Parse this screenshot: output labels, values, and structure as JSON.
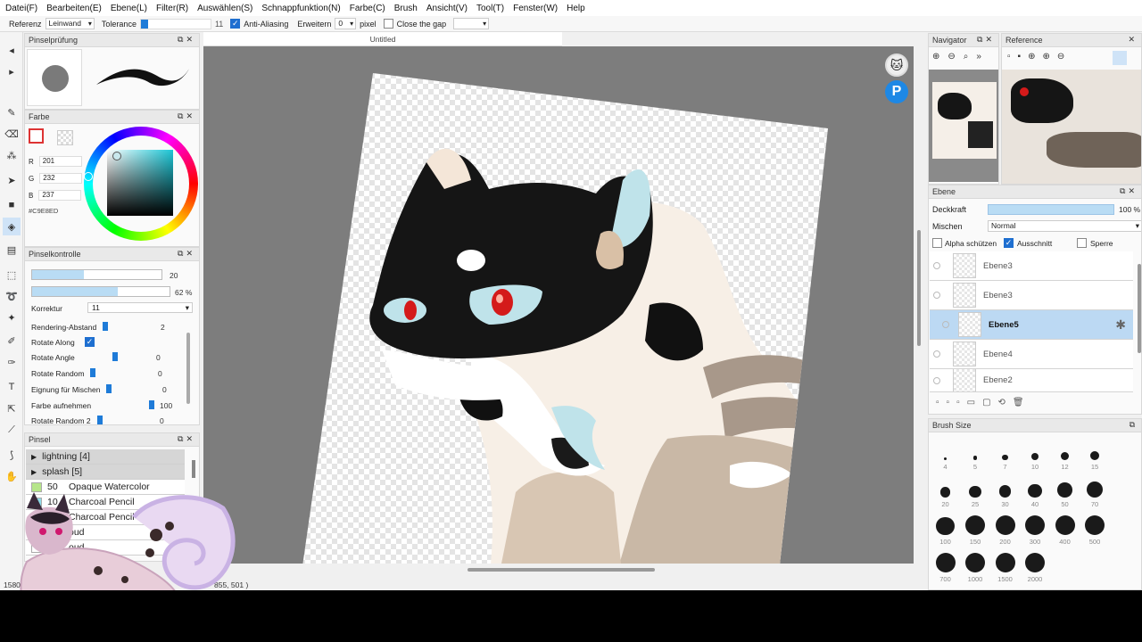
{
  "menu": [
    "Datei(F)",
    "Bearbeiten(E)",
    "Ebene(L)",
    "Filter(R)",
    "Auswählen(S)",
    "Schnappfunktion(N)",
    "Farbe(C)",
    "Brush",
    "Ansicht(V)",
    "Tool(T)",
    "Fenster(W)",
    "Help"
  ],
  "toolbar": {
    "referenz_label": "Referenz",
    "referenz_value": "Leinwand",
    "tolerance_label": "Tolerance",
    "tolerance_value": "11",
    "antialias_label": "Anti-Aliasing",
    "erweitern_label": "Erweitern",
    "erweitern_value": "0",
    "pixel_label": "pixel",
    "close_gap_label": "Close the gap"
  },
  "brush_preview": {
    "title": "Pinselprüfung"
  },
  "color_panel": {
    "title": "Farbe",
    "r_label": "R",
    "r_value": "201",
    "g_label": "G",
    "g_value": "232",
    "b_label": "B",
    "b_value": "237",
    "hex": "#C9E8ED",
    "fg_hex": "#ffffff"
  },
  "brush_control": {
    "title": "Pinselkontrolle",
    "size_value": "20",
    "opacity_value": "62 %",
    "korrektur_label": "Korrektur",
    "korrektur_value": "11",
    "rendering_label": "Rendering-Abstand",
    "rendering_value": "2",
    "rotate_along_label": "Rotate Along",
    "rotate_angle_label": "Rotate Angle",
    "rotate_angle_value": "0",
    "rotate_random_label": "Rotate Random",
    "rotate_random_value": "0",
    "eignung_label": "Eignung für Mischen",
    "eignung_value": "0",
    "farbe_label": "Farbe aufnehmen",
    "farbe_value": "100",
    "rotate_random2_label": "Rotate Random 2",
    "rotate_random2_value": "0"
  },
  "brush_list": {
    "title": "Pinsel",
    "items": [
      {
        "group": true,
        "label": "lightning [4]"
      },
      {
        "group": true,
        "label": "splash [5]"
      },
      {
        "group": false,
        "num": "50",
        "label": "Opaque Watercolor",
        "color": "#b6e58a"
      },
      {
        "group": false,
        "num": "10",
        "label": "Charcoal Pencil",
        "color": "#8fdbe8"
      },
      {
        "group": false,
        "num": "",
        "label": "Charcoal Pencil",
        "color": "#ffffff"
      },
      {
        "group": false,
        "num": "",
        "label": "oud",
        "color": "#ffffff"
      },
      {
        "group": false,
        "num": "",
        "label": "oud",
        "color": "#ffffff"
      }
    ]
  },
  "document": {
    "tab_title": "Untitled",
    "status_coords": "855, 501 )",
    "status_left": "1580"
  },
  "navigator": {
    "title": "Navigator"
  },
  "reference": {
    "title": "Reference"
  },
  "layers": {
    "title": "Ebene",
    "opacity_label": "Deckkraft",
    "opacity_value": "100 %",
    "blend_label": "Mischen",
    "blend_value": "Normal",
    "alpha_label": "Alpha schützen",
    "clip_label": "Ausschnitt",
    "lock_label": "Sperre",
    "items": [
      {
        "name": "Ebene3",
        "selected": false
      },
      {
        "name": "Ebene3",
        "selected": false
      },
      {
        "name": "Ebene5",
        "selected": true
      },
      {
        "name": "Ebene4",
        "selected": false
      },
      {
        "name": "Ebene2",
        "selected": false
      }
    ]
  },
  "brush_size": {
    "title": "Brush Size",
    "sizes": [
      "4",
      "5",
      "7",
      "10",
      "12",
      "15",
      "20",
      "25",
      "30",
      "40",
      "50",
      "70",
      "100",
      "150",
      "200",
      "300",
      "400",
      "500",
      "700",
      "1000",
      "1500",
      "2000"
    ]
  },
  "colors": {
    "accent": "#1e7bd8",
    "selected_layer": "#bcd9f3",
    "canvas_bg": "#7d7d7d"
  }
}
